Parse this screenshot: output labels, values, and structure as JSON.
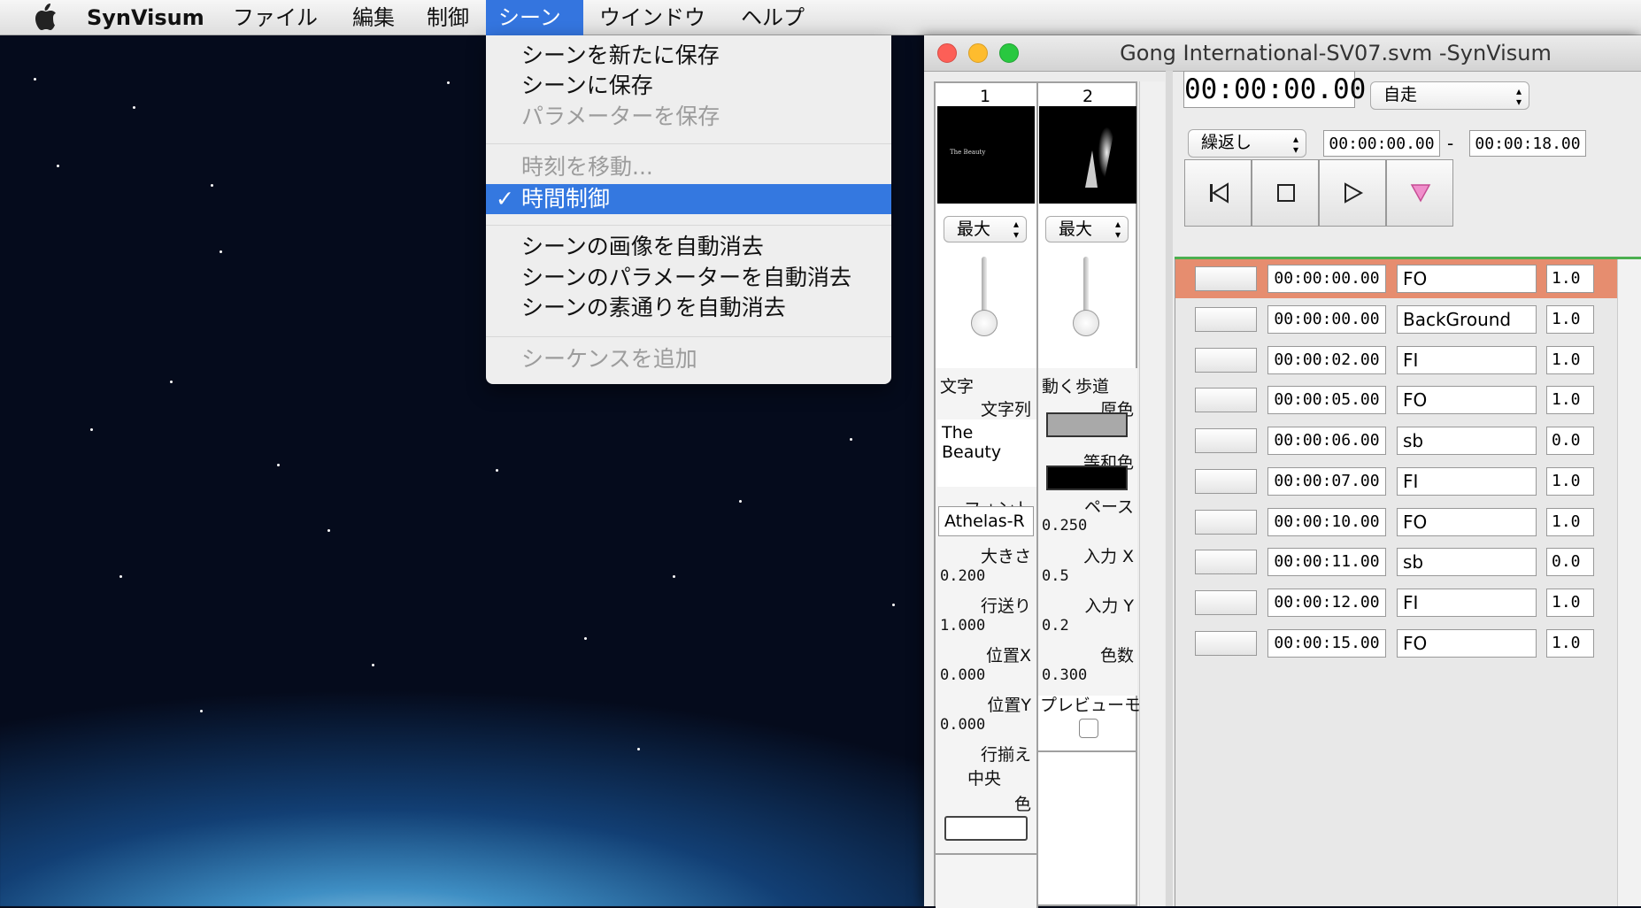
{
  "menubar": {
    "app_name": "SynVisum",
    "items": [
      "ファイル",
      "編集",
      "制御",
      "シーン",
      "ウインドウ",
      "ヘルプ"
    ],
    "active_item": "シーン"
  },
  "scene_menu": {
    "save_new": "シーンを新たに保存",
    "save": "シーンに保存",
    "save_params": "パラメーターを保存",
    "move_time": "時刻を移動...",
    "time_control": "時間制御",
    "time_control_check": "✓",
    "auto_clear_images": "シーンの画像を自動消去",
    "auto_clear_params": "シーンのパラメーターを自動消去",
    "auto_clear_passthrough": "シーンの素通りを自動消去",
    "add_sequence": "シーケンスを追加"
  },
  "window": {
    "title": "Gong International-SV07.svm -SynVisum"
  },
  "scene_columns": [
    {
      "number": "1",
      "size_popup": "最大"
    },
    {
      "number": "2",
      "size_popup": "最大"
    }
  ],
  "text_params": {
    "section": "文字",
    "string_label": "文字列",
    "string_value": "The Beauty",
    "font_label": "フォント",
    "font_value": "Athelas-R",
    "size_label": "大きさ",
    "size_value": "0.200",
    "line_spacing_label": "行送り",
    "line_spacing_value": "1.000",
    "pos_x_label": "位置X",
    "pos_x_value": "0.000",
    "pos_y_label": "位置Y",
    "pos_y_value": "0.000",
    "align_label": "行揃え",
    "align_value": "中央",
    "color_label": "色"
  },
  "walk_params": {
    "section": "動く歩道",
    "primary_color_label": "原色",
    "complementary_color_label": "等和色",
    "pace_label": "ペース",
    "pace_value": "0.250",
    "input_x_label": "入力 X",
    "input_x_value": "0.5",
    "input_y_label": "入力 Y",
    "input_y_value": "0.2",
    "color_count_label": "色数",
    "color_count_value": "0.300",
    "preview_label": "プレビューモ"
  },
  "controls": {
    "timecode": "00:00:00.00",
    "run_mode": "自走",
    "loop_mode": "繰返し",
    "range_start": "00:00:00.00",
    "range_sep": "-",
    "range_end": "00:00:18.00"
  },
  "cues": [
    {
      "time": "00:00:00.00",
      "name": "FO",
      "value": "1.0"
    },
    {
      "time": "00:00:00.00",
      "name": "BackGround",
      "value": "1.0"
    },
    {
      "time": "00:00:02.00",
      "name": "FI",
      "value": "1.0"
    },
    {
      "time": "00:00:05.00",
      "name": "FO",
      "value": "1.0"
    },
    {
      "time": "00:00:06.00",
      "name": "sb",
      "value": "0.0"
    },
    {
      "time": "00:00:07.00",
      "name": "FI",
      "value": "1.0"
    },
    {
      "time": "00:00:10.00",
      "name": "FO",
      "value": "1.0"
    },
    {
      "time": "00:00:11.00",
      "name": "sb",
      "value": "0.0"
    },
    {
      "time": "00:00:12.00",
      "name": "FI",
      "value": "1.0"
    },
    {
      "time": "00:00:15.00",
      "name": "FO",
      "value": "1.0"
    }
  ],
  "colors": {
    "menu_highlight": "#3478e0",
    "cue_highlight": "#e68d6f",
    "close": "#fd5f57",
    "minimize": "#febc2e",
    "zoom": "#29c840"
  }
}
